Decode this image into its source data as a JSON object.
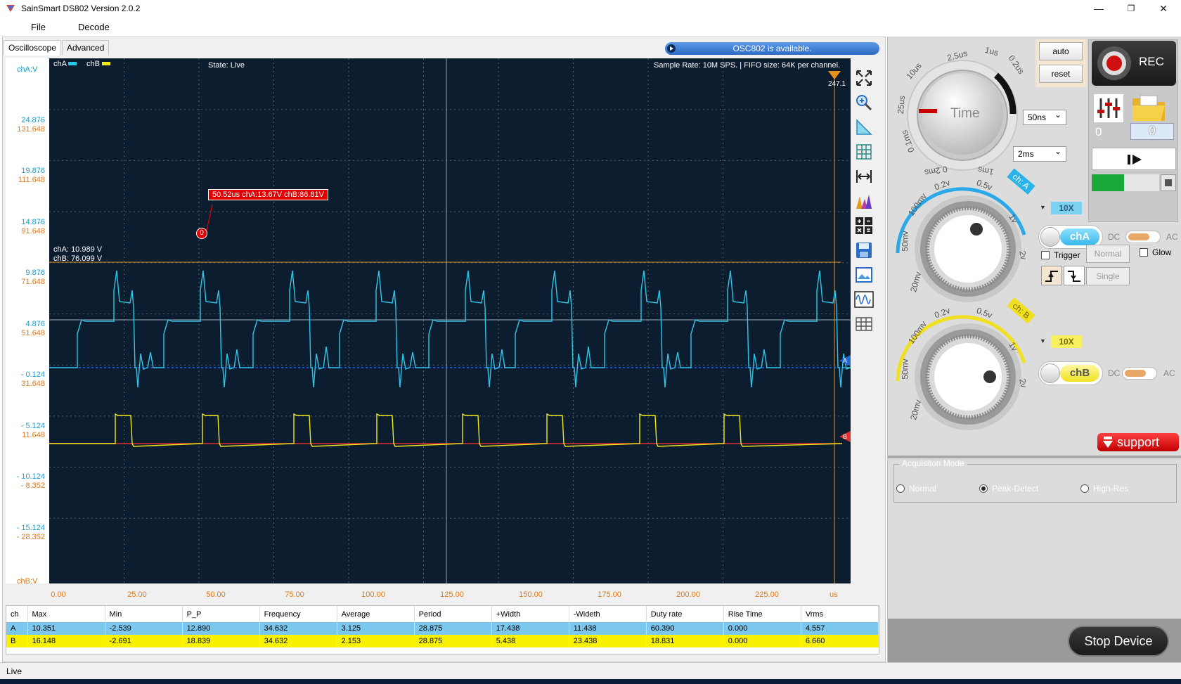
{
  "window": {
    "title": "SainSmart DS802  Version 2.0.2",
    "minimize": "—",
    "maximize": "❐",
    "close": "✕"
  },
  "menu": {
    "file": "File",
    "decode": "Decode"
  },
  "tabs": {
    "oscilloscope": "Oscilloscope",
    "advanced": "Advanced"
  },
  "banner": "OSC802  is available.",
  "scope": {
    "cha_legend": "chA",
    "chb_legend": "chB",
    "state": "State: Live",
    "sample_info": "Sample Rate: 10M SPS. | FIFO size: 64K per channel.",
    "trigger_readout": "247.1",
    "y_unit_a": "chA:V",
    "y_unit_b": "chB:V",
    "x_unit": "us",
    "cursor_a": "chA: 10.989 V",
    "cursor_b": "chB: 76.099 V",
    "marker_label": "50.52us chA:13.67V  chB:86.81V",
    "marker_index": "0",
    "a_marker": "A",
    "b_marker": "B",
    "y_labels": [
      {
        "a": "24.876",
        "b": "131.648"
      },
      {
        "a": "19.876",
        "b": "111.648"
      },
      {
        "a": "14.876",
        "b": "91.648"
      },
      {
        "a": "9.876",
        "b": "71.648"
      },
      {
        "a": "4.876",
        "b": "51.648"
      },
      {
        "a": "- 0.124",
        "b": "31.648"
      },
      {
        "a": "- 5.124",
        "b": "11.648"
      },
      {
        "a": "- 10.124",
        "b": "- 8.352"
      },
      {
        "a": "- 15.124",
        "b": "- 28.352"
      }
    ],
    "x_labels": [
      "0.00",
      "25.00",
      "50.00",
      "75.00",
      "100.00",
      "125.00",
      "150.00",
      "175.00",
      "200.00",
      "225.00"
    ]
  },
  "colors": {
    "cha": "#2ec6e8",
    "chb": "#f2ea18",
    "plot_bg": "#0c1d30",
    "grid": "#55606c",
    "cursor": "#e8921a"
  },
  "measurements": {
    "headers": [
      "ch",
      "Max",
      "Min",
      "P_P",
      "Frequency",
      "Average",
      "Period",
      "+Width",
      "-Wideth",
      "Duty rate",
      "Rise Time",
      "Vrms"
    ],
    "rows": [
      [
        "A",
        "10.351",
        "-2.539",
        "12.890",
        "34.632",
        "3.125",
        "28.875",
        "17.438",
        "11.438",
        "60.390",
        "0.000",
        "4.557"
      ],
      [
        "B",
        "16.148",
        "-2.691",
        "18.839",
        "34.632",
        "2.153",
        "28.875",
        "5.438",
        "23.438",
        "18.831",
        "0.000",
        "6.660"
      ]
    ]
  },
  "status": "Live",
  "panel": {
    "auto": "auto",
    "reset": "reset",
    "rec": "REC",
    "time_knob": "Time",
    "time_scale": [
      "2.5us",
      "1us",
      "0.2us",
      "10us",
      "25us",
      "0.1ms",
      "0.2ms",
      "1ms"
    ],
    "time_sel_top": "50ns",
    "time_sel_bottom": "2ms",
    "counter_left": "0",
    "counter_value": "0",
    "cha_badge": "ch: A",
    "chb_badge": "ch: B",
    "volt_scale": [
      "20mv",
      "50mv",
      "100mv",
      "0.2v",
      "0.5v",
      "1v",
      "2v"
    ],
    "cha_probe": "10X",
    "chb_probe": "10X",
    "cha_btn": "chA",
    "chb_btn": "chB",
    "dc": "DC",
    "ac": "AC",
    "trigger": "Trigger",
    "trig_normal": "Normal",
    "trig_single": "Single",
    "glow": "Glow",
    "support": "support",
    "acq_title": "Acquisiton Mode",
    "acq_normal": "Normal",
    "acq_peak": "Peak-Detect",
    "acq_highres": "High-Res",
    "stop": "Stop Device"
  }
}
